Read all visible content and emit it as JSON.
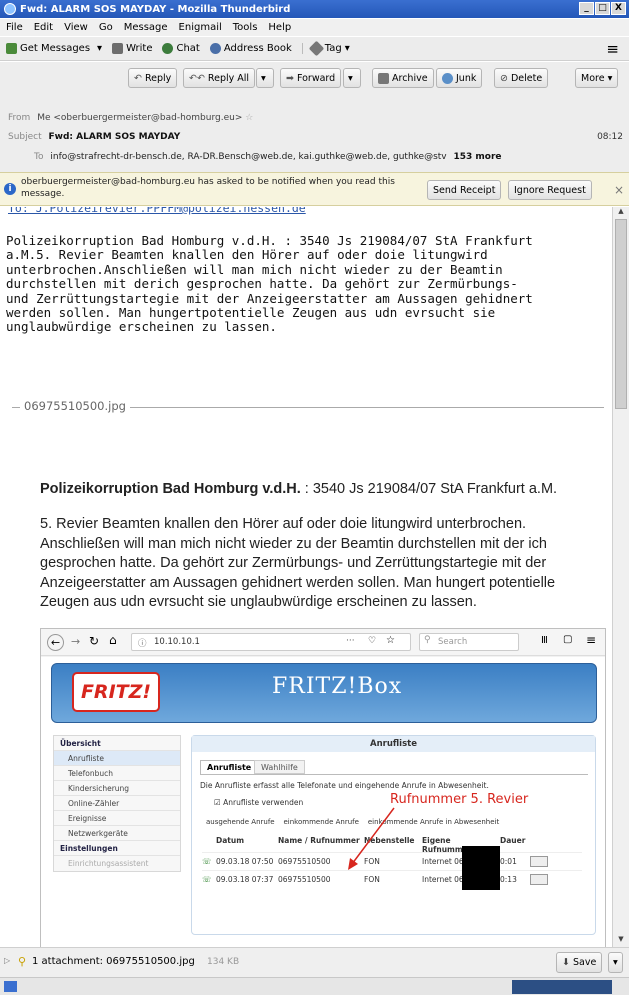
{
  "window": {
    "title": "Fwd: ALARM SOS MAYDAY - Mozilla Thunderbird",
    "min": "_",
    "max": "□",
    "close": "X"
  },
  "menu": [
    "File",
    "Edit",
    "View",
    "Go",
    "Message",
    "Enigmail",
    "Tools",
    "Help"
  ],
  "toolbar": {
    "get_messages": "Get Messages",
    "write": "Write",
    "chat": "Chat",
    "address_book": "Address Book",
    "tag": "Tag",
    "menu_glyph": "≡"
  },
  "header": {
    "reply": "Reply",
    "reply_all": "Reply All",
    "forward": "Forward",
    "archive": "Archive",
    "junk": "Junk",
    "delete": "Delete",
    "more": "More",
    "from_label": "From",
    "from_value": "Me <oberbuergermeister@bad-homburg.eu>",
    "subject_label": "Subject",
    "subject_value": "Fwd: ALARM SOS MAYDAY",
    "time": "08:12",
    "to_label": "To",
    "to_value": "info@strafrecht-dr-bensch.de, RA-DR.Bensch@web.de, kai.guthke@web.de, guthke@stv",
    "more_count": "153 more"
  },
  "notification": {
    "text": "oberbuergermeister@bad-homburg.eu has asked to be notified when you read this message.",
    "send_receipt": "Send Receipt",
    "ignore": "Ignore Request",
    "close": "×"
  },
  "body": {
    "to_cut": "To: J.Polizeirevier.PPFFM@polizei.hessen.de",
    "text": "Polizeikorruption Bad Homburg v.d.H. : 3540 Js 219084/07 StA Frankfurt\na.M.5. Revier Beamten knallen den Hörer auf oder doie litungwird\nunterbrochen.Anschließen will man mich nicht wieder zu der Beamtin\ndurchstellen mit derich gesprochen hatte. Da gehört zur Zermürbungs-\nund Zerrüttungstartegie mit der Anzeigeerstatter am Aussagen gehidnert\nwerden sollen. Man hungertpotentielle Zeugen aus udn evrsucht sie\nunglaubwürdige erscheinen zu lassen.",
    "attachment_divider": "06975510500.jpg"
  },
  "image": {
    "heading_bold": "Polizeikorruption Bad Homburg v.d.H.",
    "heading_rest": " : 3540 Js 219084/07 StA Frankfurt a.M.",
    "paragraph": "5. Revier Beamten knallen den Hörer auf oder doie litungwird unterbrochen. Anschließen will man mich nicht wieder zu der Beamtin durchstellen mit der ich gesprochen hatte. Da gehört zur Zermürbungs- und Zerrüttungstartegie mit der Anzeigeerstatter am Aussagen gehidnert werden sollen. Man hungert potentielle Zeugen aus udn evrsucht sie unglaubwürdige erscheinen zu lassen.",
    "browser": {
      "url": "10.10.10.1",
      "search": "Search",
      "dots": "···"
    },
    "fritz": {
      "logo": "FRITZ!",
      "title": "FRITZ!Box",
      "sidebar": [
        "Übersicht",
        "Anrufliste",
        "Telefonbuch",
        "Kindersicherung",
        "Online-Zähler",
        "Ereignisse",
        "Netzwerkgeräte",
        "Einstellungen",
        "Einrichtungsassistent"
      ],
      "panel_title": "Anrufliste",
      "tab1": "Anrufliste",
      "tab2": "Wahlhilfe",
      "desc": "Die Anrufliste erfasst alle Telefonate und eingehende Anrufe in Abwesenheit.",
      "checkbox": "Anrufliste verwenden",
      "legend": "ausgehende Anrufe    einkommende Anrufe    einkommende Anrufe in Abwesenheit",
      "annotation": "Rufnummer 5. Revier",
      "cols": [
        "Datum",
        "Name / Rufnummer",
        "Nebenstelle",
        "Eigene Rufnummer",
        "Dauer"
      ],
      "rows": [
        [
          "09.03.18 07:50",
          "06975510500",
          "FON",
          "Internet 069",
          "0:01"
        ],
        [
          "09.03.18 07:37",
          "06975510500",
          "FON",
          "Internet 069",
          "0:13"
        ]
      ]
    }
  },
  "attachments": {
    "label": "1 attachment: 06975510500.jpg",
    "size": "134 KB",
    "save": "Save"
  }
}
